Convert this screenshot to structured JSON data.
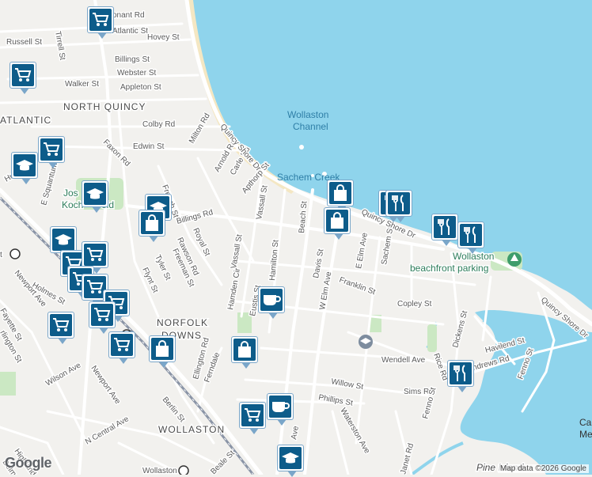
{
  "map": {
    "water_color": "#8fd4ec",
    "land_color": "#f2f1ee",
    "beach_color": "#f4e7c3",
    "park_color": "#cbe8c3",
    "road_color": "#ffffff",
    "rail_color": "#8a94a6",
    "marker_color": "#0d5c8a"
  },
  "labels": {
    "area": [
      "NORTH QUINCY",
      "ATLANTIC",
      "NORFOLK",
      "DOWNS",
      "WOLLASTON"
    ],
    "water": [
      "Wollaston",
      "Channel",
      "Sachem Creek"
    ],
    "park": [
      "Jos",
      "Koch",
      "eld",
      "Wollaston",
      "beachfront parking"
    ],
    "streets": [
      "Russell St",
      "Tirrell St",
      "onant Rd",
      "Atlantic St",
      "Hovey St",
      "Billings St",
      "Webster St",
      "Walker St",
      "Appleton St",
      "Colby Rd",
      "Milton Rd",
      "Faxon Rd",
      "Edwin St",
      "Arnold Rd",
      "Carle Rd",
      "Apthorp St",
      "E Squantum St",
      "Hunt St",
      "French St",
      "Billings Rd",
      "Royal St",
      "Rawson Rd",
      "Tyler St",
      "Freeman St",
      "Flynt St",
      "Vassall St",
      "Beach St",
      "Hamden Cir",
      "Hamilton St",
      "Eustis St",
      "Holmes St",
      "Newport Ave",
      "Fayette St",
      "rlington St",
      "Wilson Ave",
      "N Central Ave",
      "Highland",
      "Belmont",
      "Ellington Rd",
      "Ferndale",
      "Berlin St",
      "Beale St",
      "Davis St",
      "W Elm Ave",
      "E Elm Ave",
      "Sachem St",
      "Franklin St",
      "Copley St",
      "Quincy Shore Dr",
      "Wendell Ave",
      "Dickens St",
      "Havilend St",
      "ndrews Rd",
      "Rice Rd",
      "Sims Rd",
      "Fenno St",
      "Willow St",
      "Phillips St",
      "Waterston Ave",
      "Janet Rd",
      "Ave",
      "Pine Island",
      "Ca",
      "Memo"
    ],
    "stations": [
      "Wollaston",
      "t"
    ]
  },
  "markers": [
    {
      "icon": "cart"
    },
    {
      "icon": "cart"
    },
    {
      "icon": "cart"
    },
    {
      "icon": "graduation"
    },
    {
      "icon": "graduation"
    },
    {
      "icon": "graduation"
    },
    {
      "icon": "bag"
    },
    {
      "icon": "graduation"
    },
    {
      "icon": "cart"
    },
    {
      "icon": "cart"
    },
    {
      "icon": "cart"
    },
    {
      "icon": "cart"
    },
    {
      "icon": "cart"
    },
    {
      "icon": "cart"
    },
    {
      "icon": "cart"
    },
    {
      "icon": "cart"
    },
    {
      "icon": "bag"
    },
    {
      "icon": "bag"
    },
    {
      "icon": "bag"
    },
    {
      "icon": "restaurant"
    },
    {
      "icon": "restaurant"
    },
    {
      "icon": "restaurant"
    },
    {
      "icon": "restaurant"
    },
    {
      "icon": "bag"
    },
    {
      "icon": "coffee"
    },
    {
      "icon": "coffee"
    },
    {
      "icon": "cart"
    },
    {
      "icon": "graduation"
    },
    {
      "icon": "restaurant"
    }
  ],
  "footer": {
    "logo": "Google",
    "attribution": "Map data ©2026 Google"
  }
}
